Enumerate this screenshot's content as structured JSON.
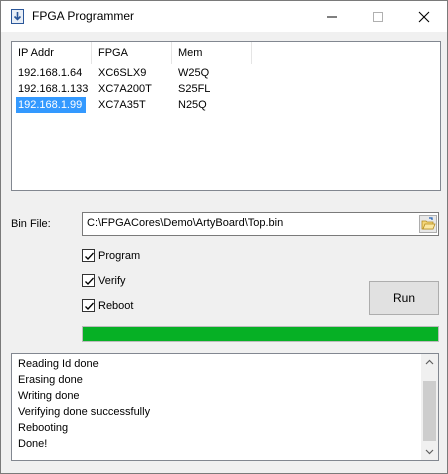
{
  "window": {
    "title": "FPGA Programmer",
    "icon": "download-arrow-icon"
  },
  "devices": {
    "columns": [
      "IP Addr",
      "FPGA",
      "Mem"
    ],
    "rows": [
      {
        "ip": "192.168.1.64",
        "fpga": "XC6SLX9",
        "mem": "W25Q"
      },
      {
        "ip": "192.168.1.133",
        "fpga": "XC7A200T",
        "mem": "S25FL"
      },
      {
        "ip": "192.168.1.99",
        "fpga": "XC7A35T",
        "mem": "N25Q"
      }
    ],
    "selected_index": 2
  },
  "bin_file": {
    "label": "Bin File:",
    "value": "C:\\FPGACores\\Demo\\ArtyBoard\\Top.bin",
    "browse_icon": "folder-open-icon"
  },
  "options": {
    "program": {
      "label": "Program",
      "checked": true
    },
    "verify": {
      "label": "Verify",
      "checked": true
    },
    "reboot": {
      "label": "Reboot",
      "checked": true
    }
  },
  "run_button": {
    "label": "Run"
  },
  "progress": {
    "fraction": 1.0,
    "color": "#06b025"
  },
  "log": {
    "lines": [
      "Reading Id done",
      "Erasing done",
      "Writing done",
      "Verifying done successfully",
      "Rebooting",
      "Done!"
    ]
  },
  "colors": {
    "selection": "#3399ff",
    "accent": "#06b025"
  }
}
